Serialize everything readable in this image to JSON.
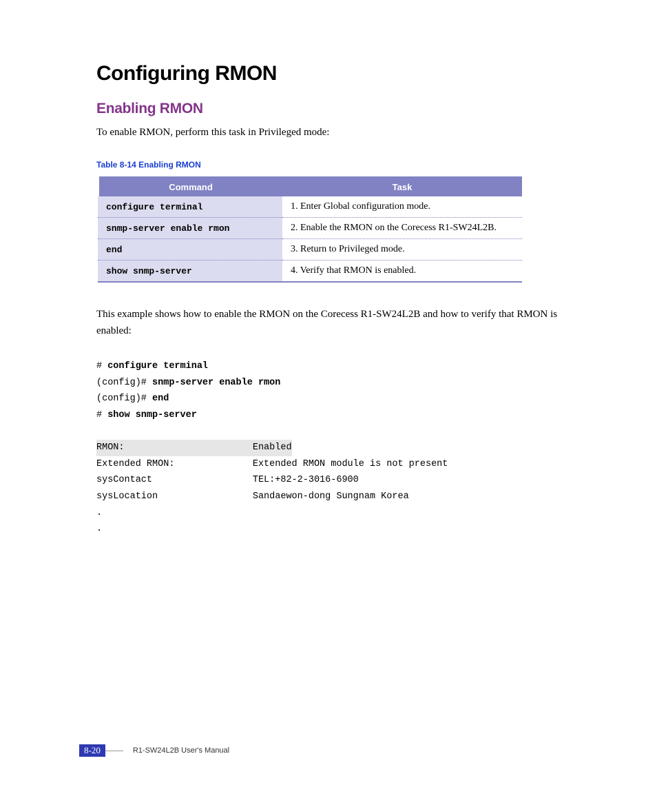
{
  "headings": {
    "h1": "Configuring RMON",
    "h2": "Enabling RMON"
  },
  "intro": "To enable RMON, perform this task in Privileged mode:",
  "table": {
    "caption": "Table 8-14   Enabling RMON",
    "headers": {
      "command": "Command",
      "task": "Task"
    },
    "rows": [
      {
        "command": "configure terminal",
        "task": "1.  Enter Global configuration mode."
      },
      {
        "command": "snmp-server enable rmon",
        "task": "2.  Enable the RMON on the Corecess R1-SW24L2B."
      },
      {
        "command": "end",
        "task": "3.  Return to Privileged mode."
      },
      {
        "command": "show snmp-server",
        "task": "4. Verify that RMON is enabled."
      }
    ]
  },
  "example_intro": "This example shows how to enable the RMON on the Corecess R1-SW24L2B and how to verify that RMON is enabled:",
  "terminal": {
    "l1p": "# ",
    "l1b": "configure terminal",
    "l2p": "(config)# ",
    "l2b": "snmp-server enable rmon",
    "l3p": "(config)# ",
    "l3b": "end",
    "l4p": "# ",
    "l4b": "show snmp-server",
    "hl_label": "RMON:                       ",
    "hl_value": "Enabled",
    "o1": "Extended RMON:              Extended RMON module is not present",
    "o2": "sysContact                  TEL:+82-2-3016-6900",
    "o3": "sysLocation                 Sandaewon-dong Sungnam Korea",
    "dot1": ".",
    "dot2": "."
  },
  "footer": {
    "page": "8-20",
    "manual": "R1-SW24L2B   User's Manual"
  }
}
